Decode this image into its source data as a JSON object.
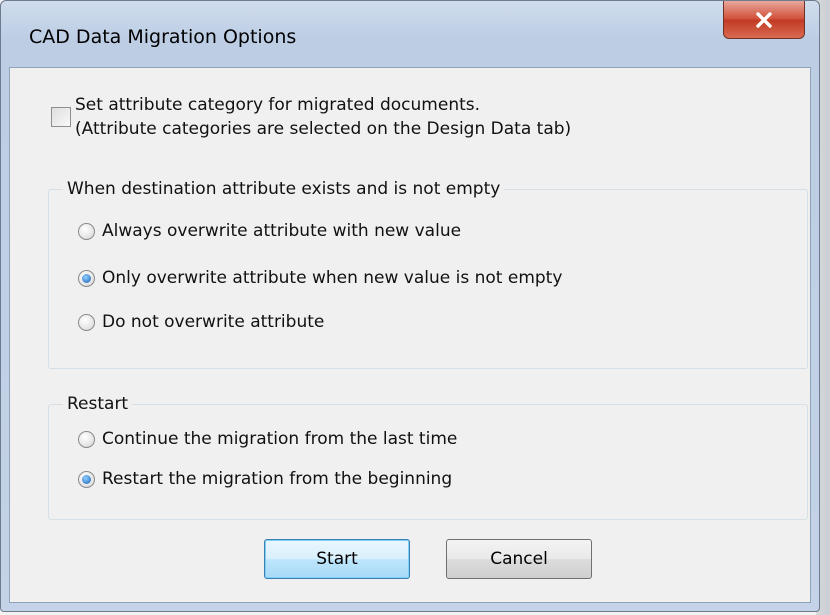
{
  "window": {
    "title": "CAD Data Migration Options"
  },
  "checkbox": {
    "checked": false,
    "line1": "Set attribute category for migrated documents.",
    "line2": "(Attribute categories are selected on the Design Data tab)"
  },
  "overwrite_group": {
    "legend": "When destination attribute exists and is not empty",
    "options": [
      {
        "label": "Always overwrite attribute with new value",
        "checked": false
      },
      {
        "label": "Only overwrite attribute when new value is not empty",
        "checked": true
      },
      {
        "label": "Do not overwrite attribute",
        "checked": false
      }
    ]
  },
  "restart_group": {
    "legend": "Restart",
    "options": [
      {
        "label": "Continue the migration from the last time",
        "checked": false
      },
      {
        "label": "Restart the migration from the beginning",
        "checked": true
      }
    ]
  },
  "buttons": {
    "start": "Start",
    "cancel": "Cancel"
  },
  "colors": {
    "close_button": "#c7432c",
    "accent": "#1a5fb4"
  }
}
